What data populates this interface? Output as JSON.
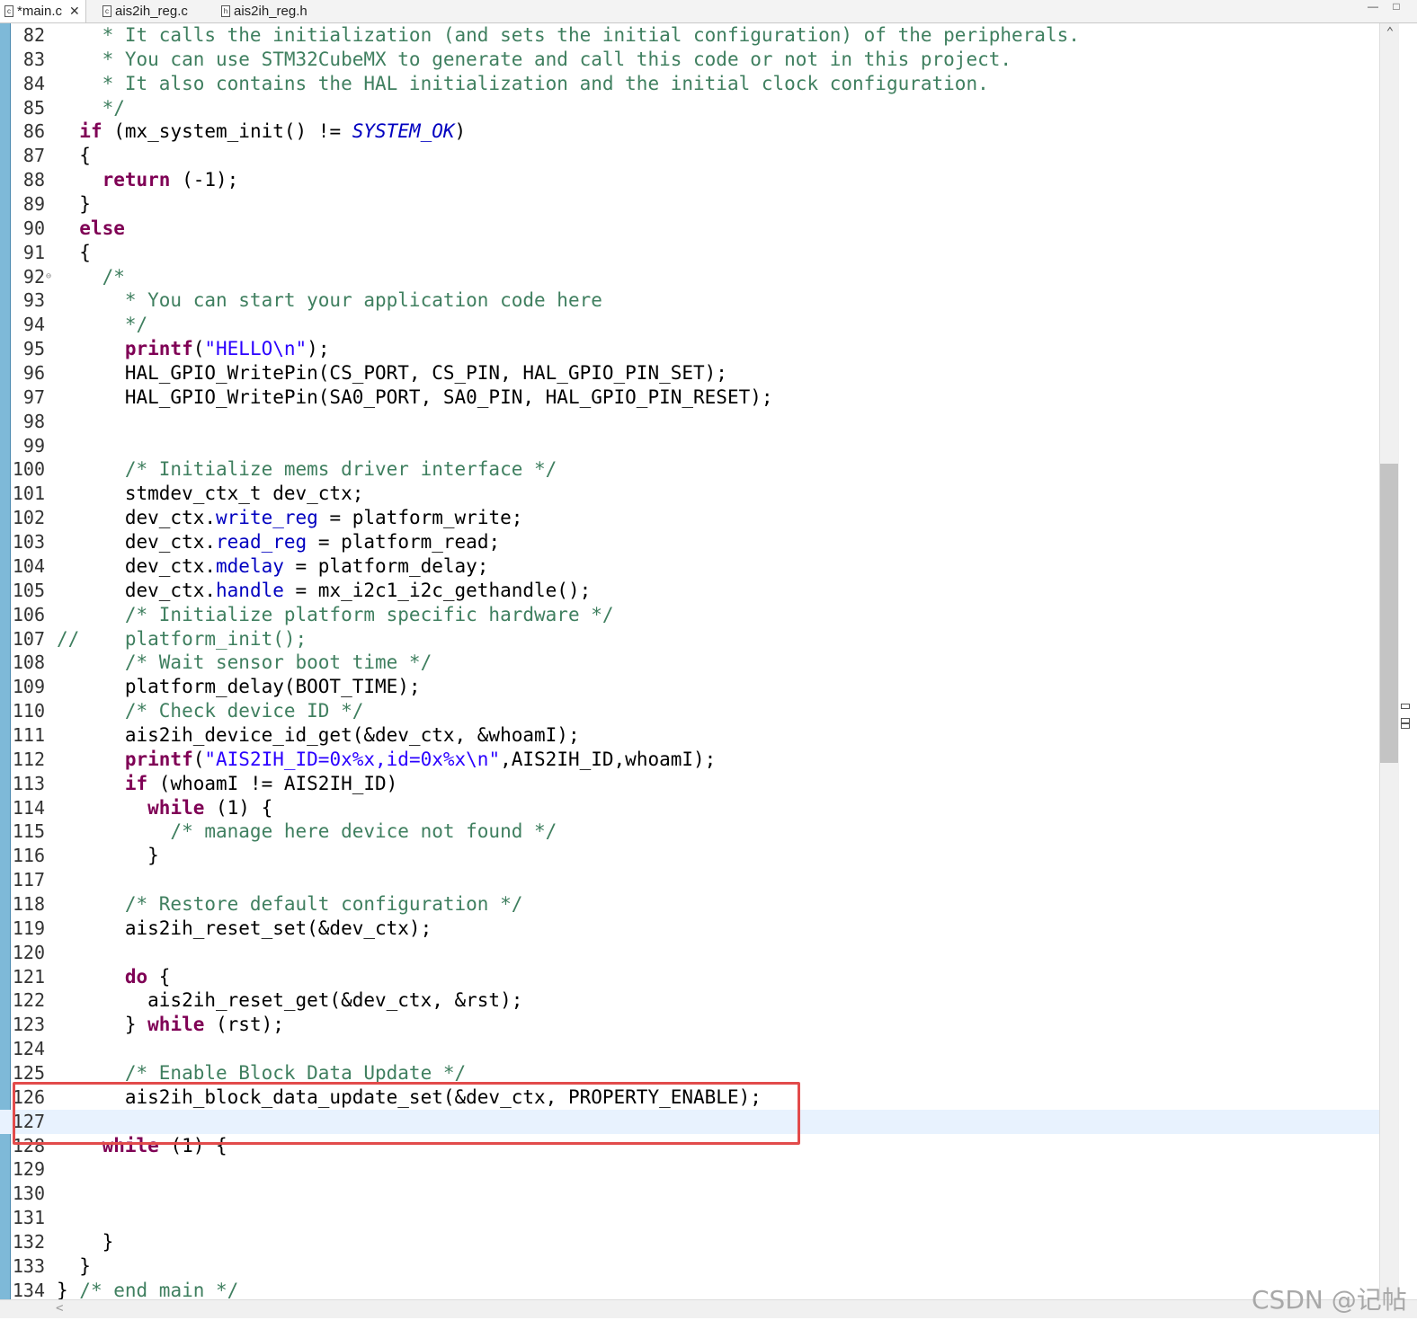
{
  "tabs": [
    {
      "label": "*main.c",
      "icon": "c-file-icon",
      "active": true,
      "closable": true
    },
    {
      "label": "ais2ih_reg.c",
      "icon": "c-file-icon",
      "active": false
    },
    {
      "label": "ais2ih_reg.h",
      "icon": "h-file-icon",
      "active": false
    }
  ],
  "window_controls": {
    "minimize": "—",
    "maximize": "□"
  },
  "editor": {
    "current_line": 127,
    "highlighted_lines": [
      125,
      126
    ],
    "lines": [
      {
        "n": "82",
        "segs": [
          [
            "c",
            "    * It calls the initialization (and sets the initial configuration) of the peripherals."
          ]
        ]
      },
      {
        "n": "83",
        "segs": [
          [
            "c",
            "    * You can use STM32CubeMX to generate and call this code or not in this project."
          ]
        ]
      },
      {
        "n": "84",
        "segs": [
          [
            "c",
            "    * It also contains the HAL initialization and the initial clock configuration."
          ]
        ]
      },
      {
        "n": "85",
        "segs": [
          [
            "c",
            "    */"
          ]
        ]
      },
      {
        "n": "86",
        "segs": [
          [
            "",
            "  "
          ],
          [
            "k",
            "if"
          ],
          [
            "",
            " (mx_system_init() != "
          ],
          [
            "mi",
            "SYSTEM_OK"
          ],
          [
            "",
            ")"
          ]
        ]
      },
      {
        "n": "87",
        "segs": [
          [
            "",
            "  {"
          ]
        ]
      },
      {
        "n": "88",
        "segs": [
          [
            "",
            "    "
          ],
          [
            "k",
            "return"
          ],
          [
            "",
            " (-1);"
          ]
        ]
      },
      {
        "n": "89",
        "segs": [
          [
            "",
            "  }"
          ]
        ]
      },
      {
        "n": "90",
        "segs": [
          [
            "",
            "  "
          ],
          [
            "k",
            "else"
          ]
        ]
      },
      {
        "n": "91",
        "segs": [
          [
            "",
            "  {"
          ]
        ]
      },
      {
        "n": "92",
        "segs": [
          [
            "c",
            "    /*"
          ]
        ],
        "fold": true
      },
      {
        "n": "93",
        "segs": [
          [
            "c",
            "      * You can start your application code here"
          ]
        ]
      },
      {
        "n": "94",
        "segs": [
          [
            "c",
            "      */"
          ]
        ]
      },
      {
        "n": "95",
        "segs": [
          [
            "",
            "      "
          ],
          [
            "k",
            "printf"
          ],
          [
            "",
            "("
          ],
          [
            "s",
            "\"HELLO\\n\""
          ],
          [
            "",
            ");"
          ]
        ]
      },
      {
        "n": "96",
        "segs": [
          [
            "",
            "      HAL_GPIO_WritePin(CS_PORT, CS_PIN, HAL_GPIO_PIN_SET);"
          ]
        ]
      },
      {
        "n": "97",
        "segs": [
          [
            "",
            "      HAL_GPIO_WritePin(SA0_PORT, SA0_PIN, HAL_GPIO_PIN_RESET);"
          ]
        ]
      },
      {
        "n": "98",
        "segs": []
      },
      {
        "n": "99",
        "segs": []
      },
      {
        "n": "100",
        "segs": [
          [
            "c",
            "      /* Initialize mems driver interface */"
          ]
        ]
      },
      {
        "n": "101",
        "segs": [
          [
            "",
            "      stmdev_ctx_t dev_ctx;"
          ]
        ]
      },
      {
        "n": "102",
        "segs": [
          [
            "",
            "      dev_ctx."
          ],
          [
            "m",
            "write_reg"
          ],
          [
            "",
            " = platform_write;"
          ]
        ]
      },
      {
        "n": "103",
        "segs": [
          [
            "",
            "      dev_ctx."
          ],
          [
            "m",
            "read_reg"
          ],
          [
            "",
            " = platform_read;"
          ]
        ]
      },
      {
        "n": "104",
        "segs": [
          [
            "",
            "      dev_ctx."
          ],
          [
            "m",
            "mdelay"
          ],
          [
            "",
            " = platform_delay;"
          ]
        ]
      },
      {
        "n": "105",
        "segs": [
          [
            "",
            "      dev_ctx."
          ],
          [
            "m",
            "handle"
          ],
          [
            "",
            " = mx_i2c1_i2c_gethandle();"
          ]
        ]
      },
      {
        "n": "106",
        "segs": [
          [
            "c",
            "      /* Initialize platform specific hardware */"
          ]
        ]
      },
      {
        "n": "107",
        "segs": [
          [
            "c",
            "//    platform_init();"
          ]
        ]
      },
      {
        "n": "108",
        "segs": [
          [
            "c",
            "      /* Wait sensor boot time */"
          ]
        ]
      },
      {
        "n": "109",
        "segs": [
          [
            "",
            "      platform_delay(BOOT_TIME);"
          ]
        ]
      },
      {
        "n": "110",
        "segs": [
          [
            "c",
            "      /* Check device ID */"
          ]
        ]
      },
      {
        "n": "111",
        "segs": [
          [
            "",
            "      ais2ih_device_id_get(&dev_ctx, &whoamI);"
          ]
        ]
      },
      {
        "n": "112",
        "segs": [
          [
            "",
            "      "
          ],
          [
            "k",
            "printf"
          ],
          [
            "",
            "("
          ],
          [
            "s",
            "\"AIS2IH_ID=0x%x,id=0x%x\\n\""
          ],
          [
            "",
            ",AIS2IH_ID,whoamI);"
          ]
        ]
      },
      {
        "n": "113",
        "segs": [
          [
            "",
            "      "
          ],
          [
            "k",
            "if"
          ],
          [
            "",
            " (whoamI != AIS2IH_ID)"
          ]
        ]
      },
      {
        "n": "114",
        "segs": [
          [
            "",
            "        "
          ],
          [
            "k",
            "while"
          ],
          [
            "",
            " (1) {"
          ]
        ]
      },
      {
        "n": "115",
        "segs": [
          [
            "c",
            "          /* manage here device not found */"
          ]
        ]
      },
      {
        "n": "116",
        "segs": [
          [
            "",
            "        }"
          ]
        ]
      },
      {
        "n": "117",
        "segs": []
      },
      {
        "n": "118",
        "segs": [
          [
            "c",
            "      /* Restore default configuration */"
          ]
        ]
      },
      {
        "n": "119",
        "segs": [
          [
            "",
            "      ais2ih_reset_set(&dev_ctx);"
          ]
        ]
      },
      {
        "n": "120",
        "segs": []
      },
      {
        "n": "121",
        "segs": [
          [
            "",
            "      "
          ],
          [
            "k",
            "do"
          ],
          [
            "",
            " {"
          ]
        ]
      },
      {
        "n": "122",
        "segs": [
          [
            "",
            "        ais2ih_reset_get(&dev_ctx, &rst);"
          ]
        ]
      },
      {
        "n": "123",
        "segs": [
          [
            "",
            "      } "
          ],
          [
            "k",
            "while"
          ],
          [
            "",
            " (rst);"
          ]
        ]
      },
      {
        "n": "124",
        "segs": []
      },
      {
        "n": "125",
        "segs": [
          [
            "c",
            "      /* Enable Block Data Update */"
          ]
        ]
      },
      {
        "n": "126",
        "segs": [
          [
            "",
            "      ais2ih_block_data_update_set(&dev_ctx, PROPERTY_ENABLE);"
          ]
        ]
      },
      {
        "n": "127",
        "segs": []
      },
      {
        "n": "128",
        "segs": [
          [
            "",
            "    "
          ],
          [
            "k",
            "while"
          ],
          [
            "",
            " (1) {"
          ]
        ]
      },
      {
        "n": "129",
        "segs": []
      },
      {
        "n": "130",
        "segs": []
      },
      {
        "n": "131",
        "segs": []
      },
      {
        "n": "132",
        "segs": [
          [
            "",
            "    }"
          ]
        ]
      },
      {
        "n": "133",
        "segs": [
          [
            "",
            "  }"
          ]
        ]
      },
      {
        "n": "134",
        "segs": [
          [
            "",
            "} "
          ],
          [
            "c",
            "/* end main */"
          ]
        ]
      }
    ]
  },
  "watermark": "CSDN @记帖"
}
